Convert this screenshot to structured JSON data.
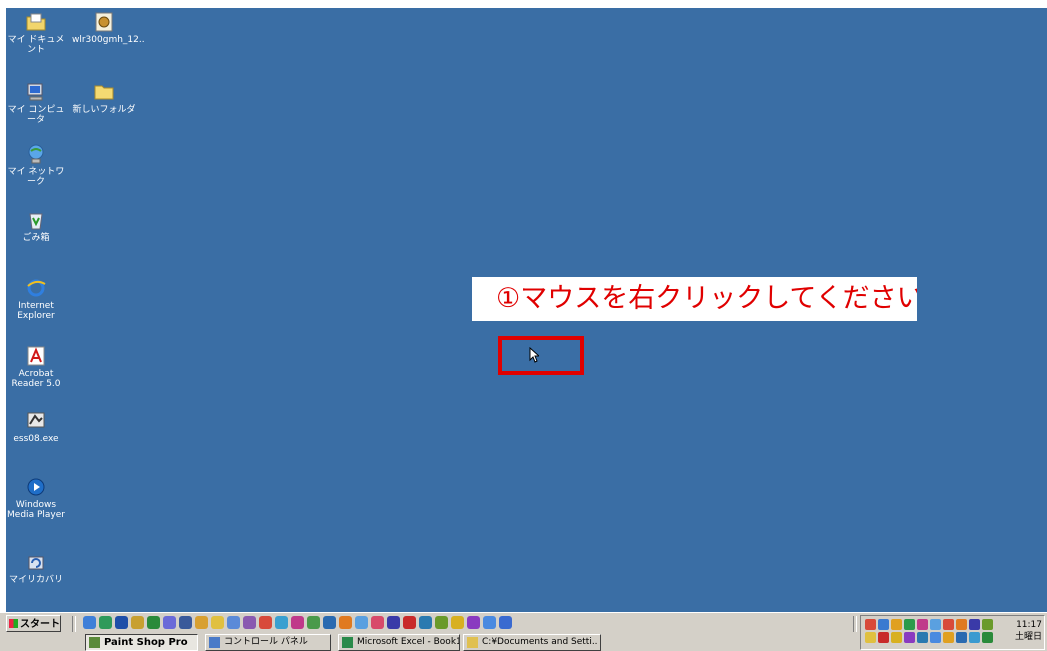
{
  "desktop_icons": [
    {
      "label": "マイ ドキュメント",
      "icon": "my-documents-icon"
    },
    {
      "label": "wlr300gmh_12..",
      "icon": "installer-icon"
    },
    {
      "label": "マイ コンピュータ",
      "icon": "my-computer-icon"
    },
    {
      "label": "新しいフォルダ",
      "icon": "folder-icon"
    },
    {
      "label": "マイ ネットワーク",
      "icon": "my-network-icon"
    },
    {
      "label": "ごみ箱",
      "icon": "recycle-bin-icon"
    },
    {
      "label": "Internet Explorer",
      "icon": "internet-explorer-icon"
    },
    {
      "label": "Acrobat Reader 5.0",
      "icon": "acrobat-reader-icon"
    },
    {
      "label": "ess08.exe",
      "icon": "ess-exe-icon"
    },
    {
      "label": "Windows Media Player",
      "icon": "windows-media-player-icon"
    },
    {
      "label": "マイリカバリ",
      "icon": "my-recovery-icon"
    }
  ],
  "annotation": {
    "instruction": "①マウスを右クリックしてください。"
  },
  "taskbar": {
    "start_label": "スタート",
    "windows": [
      {
        "label": "Paint Shop Pro",
        "active": true
      },
      {
        "label": "コントロール パネル",
        "active": false
      },
      {
        "label": "Microsoft Excel - Book1",
        "active": false
      },
      {
        "label": "C:¥Documents and Setti..",
        "active": false
      }
    ],
    "clock_time": "11:17",
    "clock_day": "土曜日"
  },
  "colors": {
    "desktop_background": "#3a6ea5",
    "annotation_red": "#e00000",
    "taskbar_gray": "#d4d0c8"
  }
}
